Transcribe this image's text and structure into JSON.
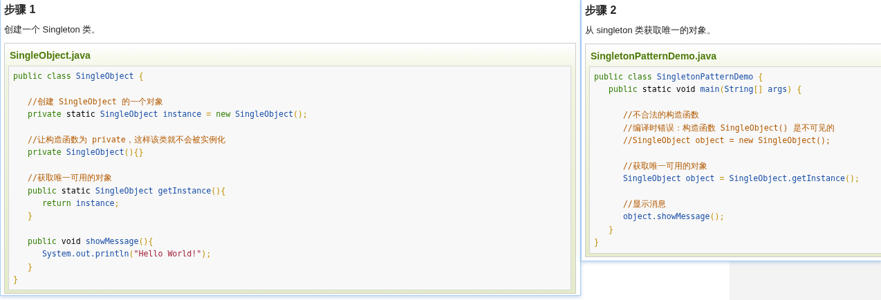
{
  "panels": [
    {
      "title": "步骤 1",
      "description": "创建一个 Singleton 类。",
      "file": {
        "name": "SingleObject.java",
        "blocks": [
          [
            [
              {
                "kind": "kw",
                "text": "public class "
              },
              {
                "kind": "id",
                "text": "SingleObject "
              },
              {
                "kind": "pun",
                "text": "{"
              }
            ]
          ],
          [
            [
              {
                "kind": "com",
                "text": "   //创建 SingleObject 的一个对象"
              }
            ],
            [
              {
                "kind": "kw",
                "text": "   private "
              },
              {
                "kind": "plain",
                "text": "static "
              },
              {
                "kind": "id",
                "text": "SingleObject instance "
              },
              {
                "kind": "pun",
                "text": "= "
              },
              {
                "kind": "kw",
                "text": "new "
              },
              {
                "kind": "id",
                "text": "SingleObject"
              },
              {
                "kind": "pun",
                "text": "();"
              }
            ]
          ],
          [
            [
              {
                "kind": "com",
                "text": "   //让构造函数为 private，这样该类就不会被实例化"
              }
            ],
            [
              {
                "kind": "kw",
                "text": "   private "
              },
              {
                "kind": "id",
                "text": "SingleObject"
              },
              {
                "kind": "pun",
                "text": "(){}"
              }
            ]
          ],
          [
            [
              {
                "kind": "com",
                "text": "   //获取唯一可用的对象"
              }
            ],
            [
              {
                "kind": "kw",
                "text": "   public "
              },
              {
                "kind": "plain",
                "text": "static "
              },
              {
                "kind": "id",
                "text": "SingleObject getInstance"
              },
              {
                "kind": "pun",
                "text": "(){"
              }
            ],
            [
              {
                "kind": "kw",
                "text": "      return "
              },
              {
                "kind": "id",
                "text": "instance"
              },
              {
                "kind": "pun",
                "text": ";"
              }
            ],
            [
              {
                "kind": "pun",
                "text": "   }"
              }
            ]
          ],
          [
            [
              {
                "kind": "kw",
                "text": "   public "
              },
              {
                "kind": "plain",
                "text": "void "
              },
              {
                "kind": "id",
                "text": "showMessage"
              },
              {
                "kind": "pun",
                "text": "(){"
              }
            ],
            [
              {
                "kind": "id",
                "text": "      System.out.println"
              },
              {
                "kind": "pun",
                "text": "("
              },
              {
                "kind": "str",
                "text": "\"Hello World!\""
              },
              {
                "kind": "pun",
                "text": ");"
              }
            ],
            [
              {
                "kind": "pun",
                "text": "   }"
              }
            ],
            [
              {
                "kind": "pun",
                "text": "}"
              }
            ]
          ]
        ]
      }
    },
    {
      "title": "步骤 2",
      "description": "从 singleton 类获取唯一的对象。",
      "file": {
        "name": "SingletonPatternDemo.java",
        "blocks": [
          [
            [
              {
                "kind": "kw",
                "text": "public class "
              },
              {
                "kind": "id",
                "text": "SingletonPatternDemo "
              },
              {
                "kind": "pun",
                "text": "{"
              }
            ],
            [
              {
                "kind": "kw",
                "text": "   public "
              },
              {
                "kind": "plain",
                "text": "static void "
              },
              {
                "kind": "id",
                "text": "main"
              },
              {
                "kind": "pun",
                "text": "("
              },
              {
                "kind": "id",
                "text": "String"
              },
              {
                "kind": "pun",
                "text": "[] "
              },
              {
                "kind": "id",
                "text": "args"
              },
              {
                "kind": "pun",
                "text": ") {"
              }
            ]
          ],
          [
            [
              {
                "kind": "com",
                "text": "      //不合法的构造函数"
              }
            ],
            [
              {
                "kind": "com",
                "text": "      //编译时错误：构造函数 SingleObject() 是不可见的"
              }
            ],
            [
              {
                "kind": "com",
                "text": "      //SingleObject object = new SingleObject();"
              }
            ]
          ],
          [
            [
              {
                "kind": "com",
                "text": "      //获取唯一可用的对象"
              }
            ],
            [
              {
                "kind": "id",
                "text": "      SingleObject object "
              },
              {
                "kind": "pun",
                "text": "= "
              },
              {
                "kind": "id",
                "text": "SingleObject.getInstance"
              },
              {
                "kind": "pun",
                "text": "();"
              }
            ]
          ],
          [
            [
              {
                "kind": "com",
                "text": "      //显示消息"
              }
            ],
            [
              {
                "kind": "id",
                "text": "      object.showMessage"
              },
              {
                "kind": "pun",
                "text": "();"
              }
            ],
            [
              {
                "kind": "pun",
                "text": "   }"
              }
            ],
            [
              {
                "kind": "pun",
                "text": "}"
              }
            ]
          ]
        ]
      }
    }
  ]
}
